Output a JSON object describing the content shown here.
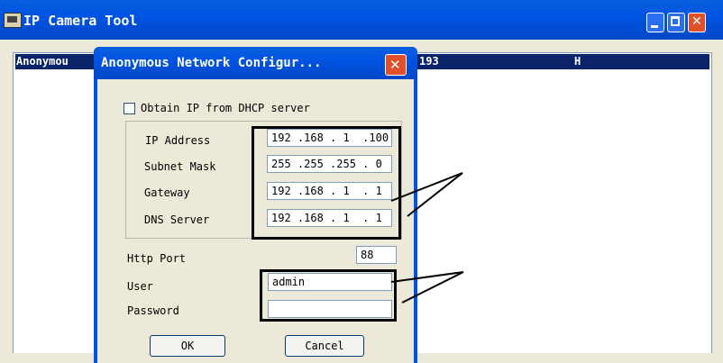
{
  "window": {
    "title": "IP Camera Tool"
  },
  "list": {
    "row": {
      "name": "Anonymou",
      "ip_tail": "193",
      "col3": "H"
    }
  },
  "dialog": {
    "title": "Anonymous Network Configur...",
    "dhcp_label": "Obtain IP from DHCP server",
    "dhcp_checked": false,
    "fields": [
      {
        "label": "IP Address",
        "value": "192 .168 . 1  .100"
      },
      {
        "label": "Subnet Mask",
        "value": "255 .255 .255 . 0"
      },
      {
        "label": "Gateway",
        "value": "192 .168 . 1  . 1"
      },
      {
        "label": "DNS Server",
        "value": "192 .168 . 1  . 1"
      }
    ],
    "http_port": {
      "label": "Http Port",
      "value": "88"
    },
    "user": {
      "label": "User",
      "value": "admin"
    },
    "password": {
      "label": "Password",
      "value": ""
    },
    "ok_label": "OK",
    "cancel_label": "Cancel"
  },
  "colors": {
    "titlebar": "#0054e3",
    "selection": "#0a246a",
    "dialog_face": "#ece9d8",
    "close": "#e0502a"
  }
}
